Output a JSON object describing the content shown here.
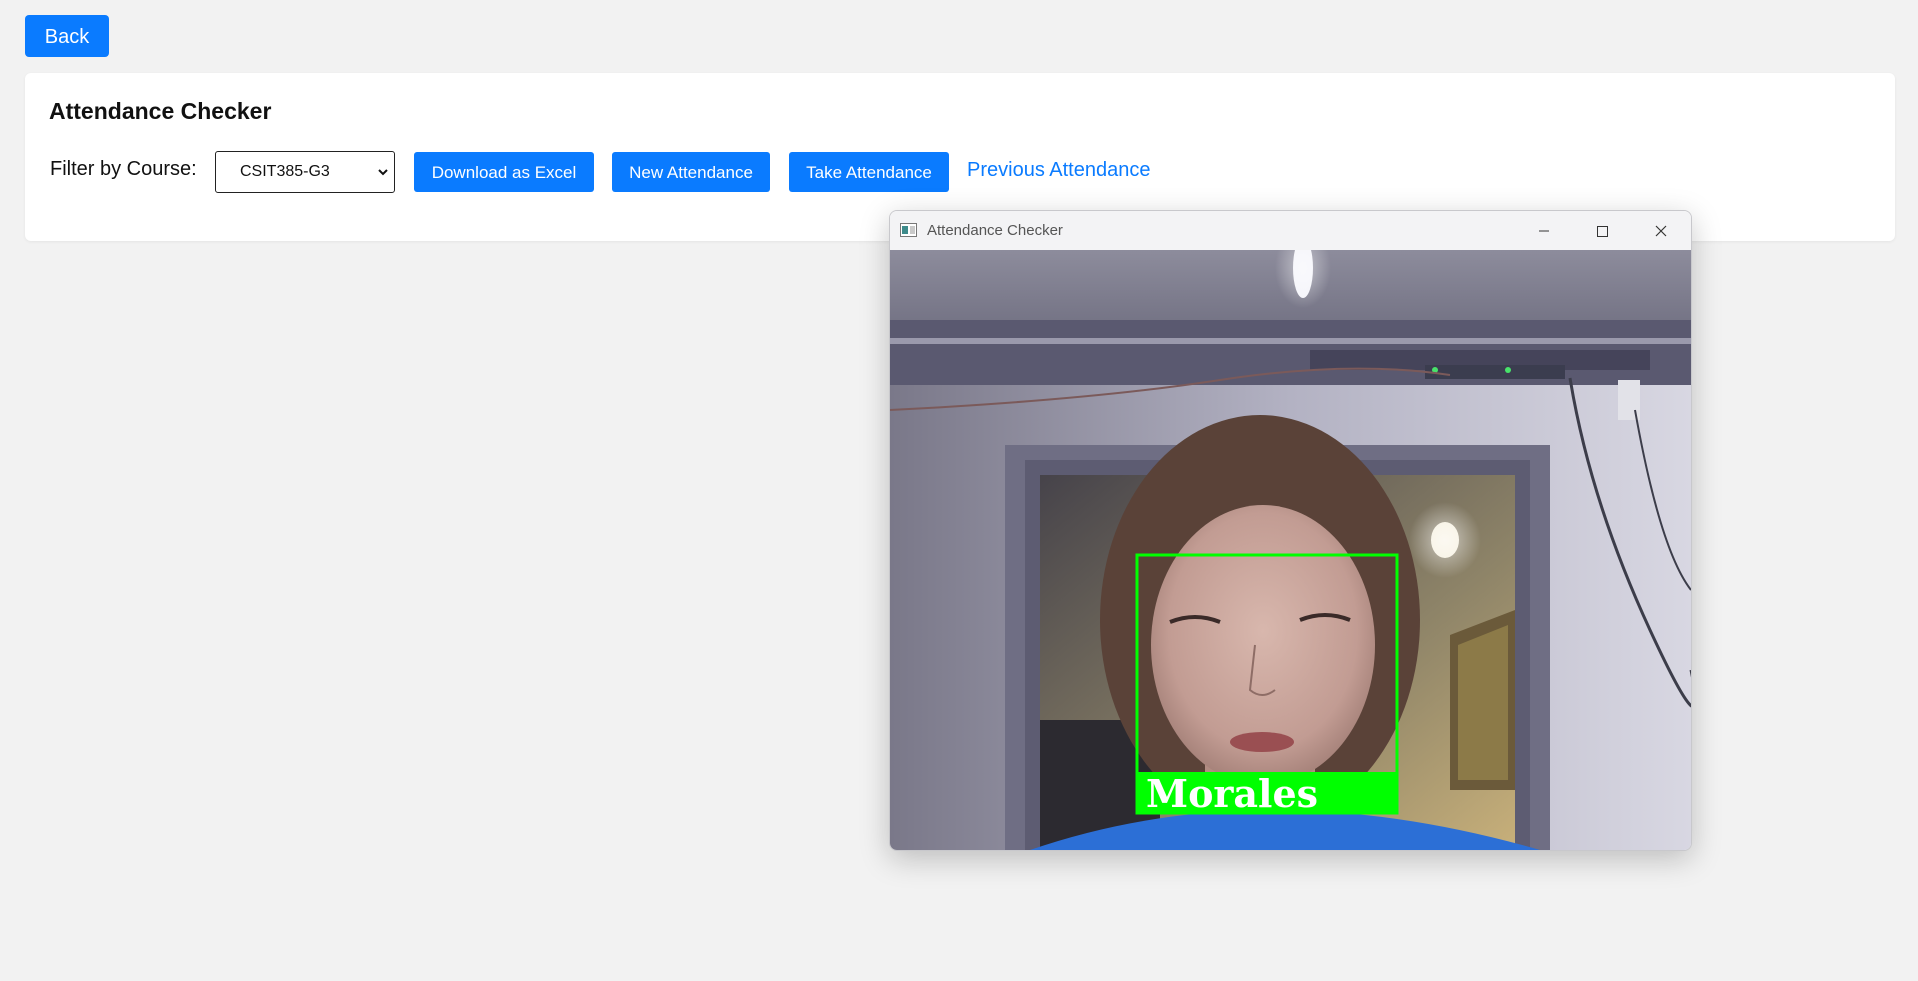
{
  "back_button": {
    "label": "Back"
  },
  "panel": {
    "title": "Attendance Checker",
    "filter_label": "Filter by Course:",
    "course_select": {
      "selected": "CSIT385-G3"
    },
    "buttons": {
      "download_excel": "Download as Excel",
      "new_attendance": "New Attendance",
      "take_attendance": "Take Attendance"
    },
    "previous_link": "Previous Attendance"
  },
  "camera_window": {
    "title": "Attendance Checker",
    "controls": [
      "minimize-icon",
      "maximize-icon",
      "close-icon"
    ],
    "recognized_name": "Morales",
    "box_color": "#00ff00"
  },
  "colors": {
    "accent": "#0a7bff",
    "background": "#f2f2f2",
    "card": "#ffffff"
  }
}
